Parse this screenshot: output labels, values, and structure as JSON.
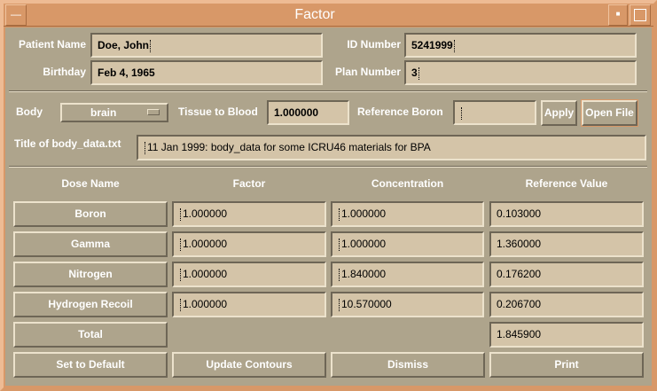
{
  "window": {
    "title": "Factor"
  },
  "patient": {
    "name_label": "Patient Name",
    "name": "Doe, John",
    "birthday_label": "Birthday",
    "birthday": "Feb 4, 1965",
    "id_label": "ID Number",
    "id": "5241999",
    "plan_label": "Plan Number",
    "plan": "3"
  },
  "body": {
    "label": "Body",
    "selected": "brain",
    "tissue_label": "Tissue to Blood",
    "tissue_value": "1.000000",
    "ref_boron_label": "Reference Boron",
    "ref_boron_value": "",
    "apply": "Apply",
    "open_file": "Open File"
  },
  "title_row": {
    "label": "Title of body_data.txt",
    "value": "11 Jan 1999: body_data for some ICRU46 materials for BPA"
  },
  "table": {
    "headers": [
      "Dose Name",
      "Factor",
      "Concentration",
      "Reference Value"
    ],
    "rows": [
      {
        "name": "Boron",
        "factor": "1.000000",
        "concentration": "1.000000",
        "reference": "0.103000"
      },
      {
        "name": "Gamma",
        "factor": "1.000000",
        "concentration": "1.000000",
        "reference": "1.360000"
      },
      {
        "name": "Nitrogen",
        "factor": "1.000000",
        "concentration": "1.840000",
        "reference": "0.176200"
      },
      {
        "name": "Hydrogen Recoil",
        "factor": "1.000000",
        "concentration": "10.570000",
        "reference": "0.206700"
      }
    ],
    "total_label": "Total",
    "total": "1.845900"
  },
  "buttons": {
    "set_default": "Set to Default",
    "update": "Update Contours",
    "dismiss": "Dismiss",
    "print": "Print"
  }
}
